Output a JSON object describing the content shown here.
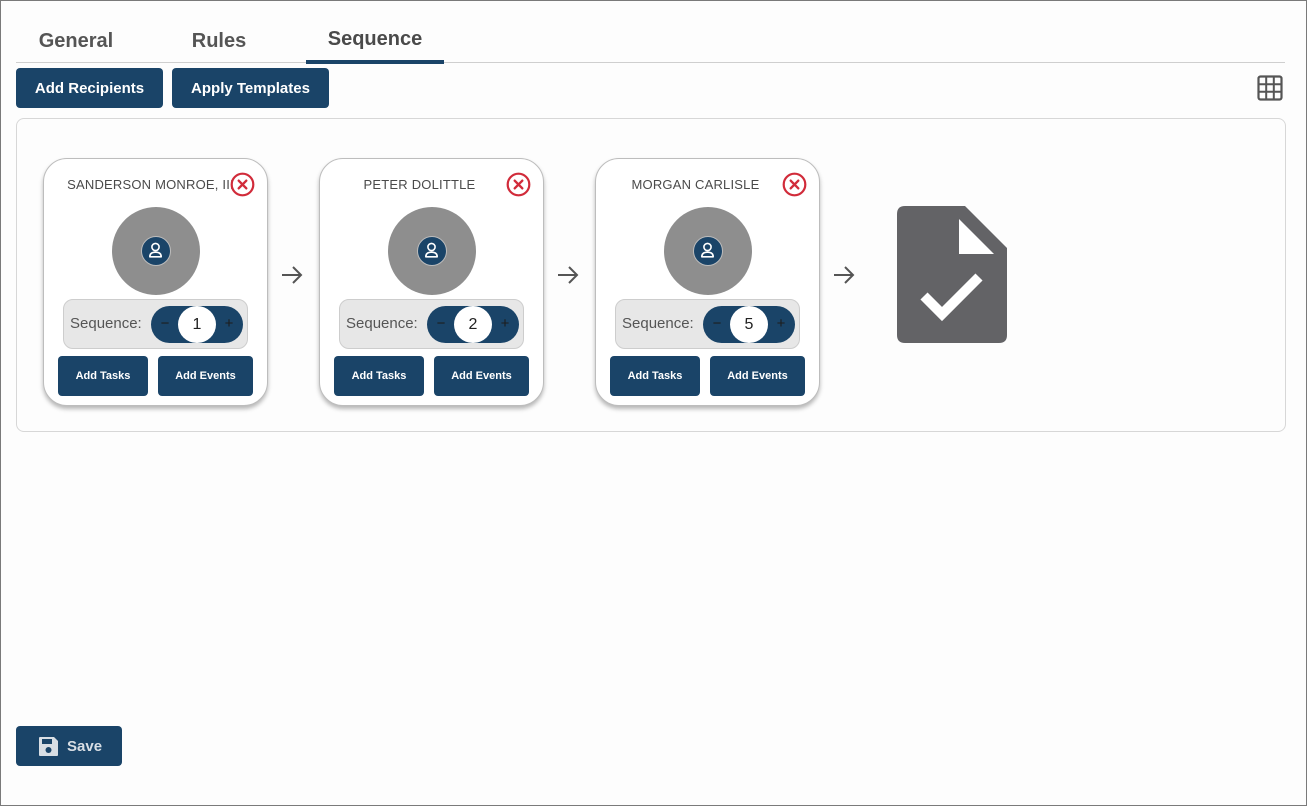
{
  "tabs": [
    {
      "label": "General",
      "active": false
    },
    {
      "label": "Rules",
      "active": false
    },
    {
      "label": "Sequence",
      "active": true
    }
  ],
  "toolbar": {
    "add_recipients_label": "Add Recipients",
    "apply_templates_label": "Apply Templates",
    "grid_icon": "grid-view-icon"
  },
  "recipients": [
    {
      "name": "SANDERSON MONROE, III",
      "sequence_label": "Sequence:",
      "sequence": "1",
      "minus": "−",
      "plus": "+",
      "add_tasks": "Add Tasks",
      "add_events": "Add Events"
    },
    {
      "name": "PETER DOLITTLE",
      "sequence_label": "Sequence:",
      "sequence": "2",
      "minus": "−",
      "plus": "+",
      "add_tasks": "Add Tasks",
      "add_events": "Add Events"
    },
    {
      "name": "MORGAN CARLISLE",
      "sequence_label": "Sequence:",
      "sequence": "5",
      "minus": "−",
      "plus": "+",
      "add_tasks": "Add Tasks",
      "add_events": "Add Events"
    }
  ],
  "icons": {
    "remove": "close-circle-icon",
    "avatar": "user-icon",
    "flow_arrow": "arrow-right-icon",
    "final": "document-check-icon",
    "save": "floppy-disk-icon"
  },
  "colors": {
    "primary": "#1a4468",
    "remove": "#d12b3a",
    "avatar_bg": "#8e8e8e",
    "doc_icon": "#636366"
  },
  "footer": {
    "save_label": "Save"
  }
}
